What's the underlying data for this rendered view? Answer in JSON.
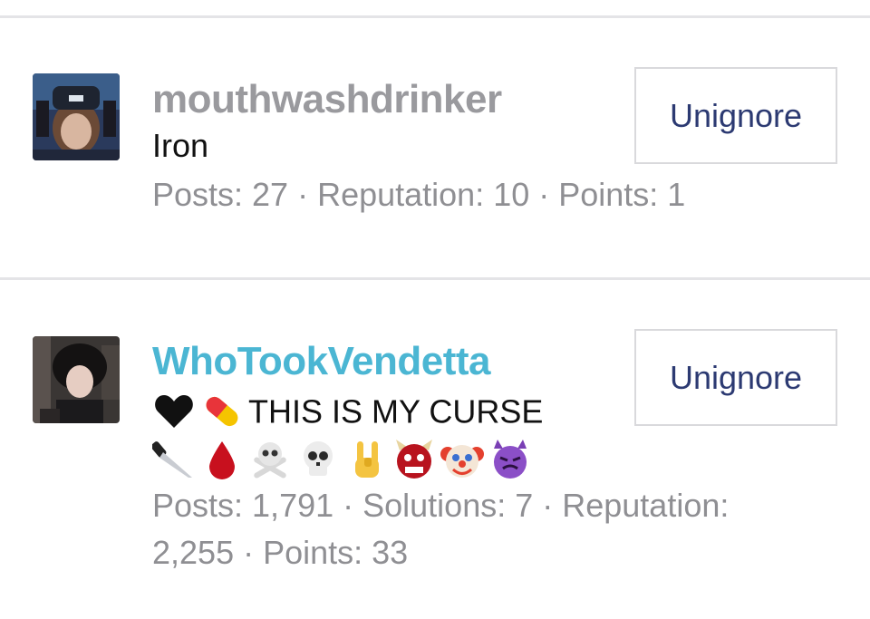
{
  "ignored_users": [
    {
      "username": "mouthwashdrinker",
      "username_color": "#9a9a9e",
      "signature": "Iron",
      "stats": "Posts: 27 · Reputation: 10 · Points: 1",
      "button_label": "Unignore"
    },
    {
      "username": "WhoTookVendetta",
      "username_color": "#4bb6d3",
      "signature_line_1_icons": [
        "black-heart-icon",
        "pill-icon"
      ],
      "signature_line_1_text": "THIS IS MY CURSE",
      "signature_line_2_icons": [
        "knife-icon",
        "blood-drop-icon",
        "skull-crossbones-icon",
        "skull-icon",
        "horns-hand-icon",
        "ogre-icon",
        "clown-icon",
        "devil-icon"
      ],
      "stats_line_1": "Posts: 1,791 · Solutions: 7 · Reputation:",
      "stats_line_2": "2,255 · Points: 33",
      "button_label": "Unignore"
    }
  ],
  "colors": {
    "button_text": "#2c3a72",
    "stats_text": "#8f8f93",
    "divider": "#e4e4e7"
  }
}
